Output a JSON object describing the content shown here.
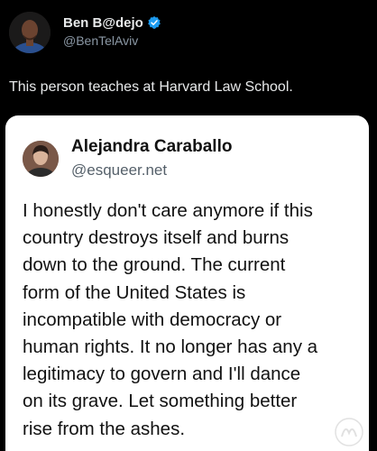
{
  "author": {
    "display_name": "Ben B@dejo",
    "handle": "@BenTelAviv",
    "avatar_icon": "avatar-photo",
    "verified_icon": "verified-badge-icon",
    "verified_color": "#1d9bf0"
  },
  "tweet": {
    "text": "This person teaches at Harvard Law School."
  },
  "quoted": {
    "display_name": "Alejandra Caraballo",
    "handle": "@esqueer.net",
    "avatar_icon": "avatar-photo",
    "body_lines": [
      "I honestly don't care anymore if this",
      "country destroys itself and burns",
      "down to the ground. The current",
      "form of the United States is",
      "incompatible with democracy or",
      "human rights. It no longer has any a",
      "legitimacy to govern and I'll dance",
      "on its grave. Let something better",
      "rise from the ashes."
    ]
  },
  "watermark": {
    "icon": "watermark-logo-icon"
  },
  "colors": {
    "background": "#000000",
    "card": "#ffffff",
    "primary_text": "#e7e9ea",
    "secondary_text": "#8b98a5",
    "quote_text": "#111111"
  }
}
